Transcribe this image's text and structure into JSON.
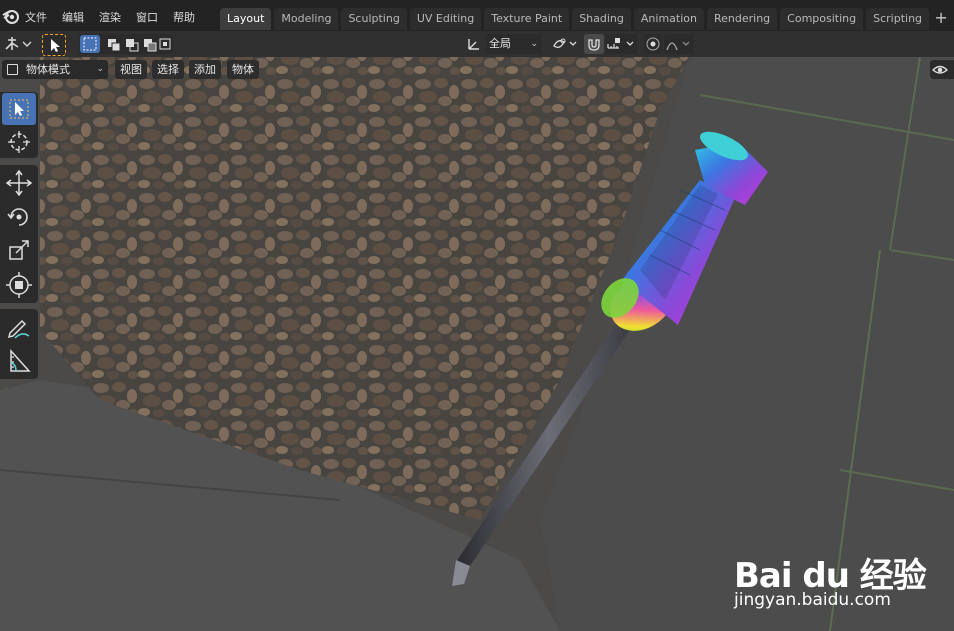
{
  "menus": [
    "文件",
    "编辑",
    "渲染",
    "窗口",
    "帮助"
  ],
  "workspace_tabs": [
    {
      "label": "Layout",
      "active": true
    },
    {
      "label": "Modeling",
      "active": false
    },
    {
      "label": "Sculpting",
      "active": false
    },
    {
      "label": "UV Editing",
      "active": false
    },
    {
      "label": "Texture Paint",
      "active": false
    },
    {
      "label": "Shading",
      "active": false
    },
    {
      "label": "Animation",
      "active": false
    },
    {
      "label": "Rendering",
      "active": false
    },
    {
      "label": "Compositing",
      "active": false
    },
    {
      "label": "Scripting",
      "active": false
    }
  ],
  "add_tab_label": "+",
  "header": {
    "transform_orientation": "全局"
  },
  "viewport_header": {
    "mode": "物体模式",
    "view": "视图",
    "select": "选择",
    "add": "添加",
    "object": "物体"
  },
  "tools": [
    {
      "name": "select-box",
      "icon": "cursor-arrow-icon",
      "active": true
    },
    {
      "name": "cursor",
      "icon": "crosshair-cursor-icon",
      "active": false
    },
    {
      "name": "move",
      "icon": "move-arrows-icon",
      "active": false
    },
    {
      "name": "rotate",
      "icon": "rotate-icon",
      "active": false
    },
    {
      "name": "scale",
      "icon": "scale-icon",
      "active": false
    },
    {
      "name": "transform",
      "icon": "transform-icon",
      "active": false
    },
    {
      "name": "annotate",
      "icon": "annotate-pen-icon",
      "active": false
    },
    {
      "name": "measure",
      "icon": "measure-ruler-icon",
      "active": false
    }
  ],
  "watermark": {
    "brand": "Bai du 经验",
    "url": "jingyan.baidu.com"
  },
  "colors": {
    "accent_blue": "#4772b3",
    "select_orange": "#f5a623",
    "menu_bar": "#232323",
    "header": "#303030"
  }
}
